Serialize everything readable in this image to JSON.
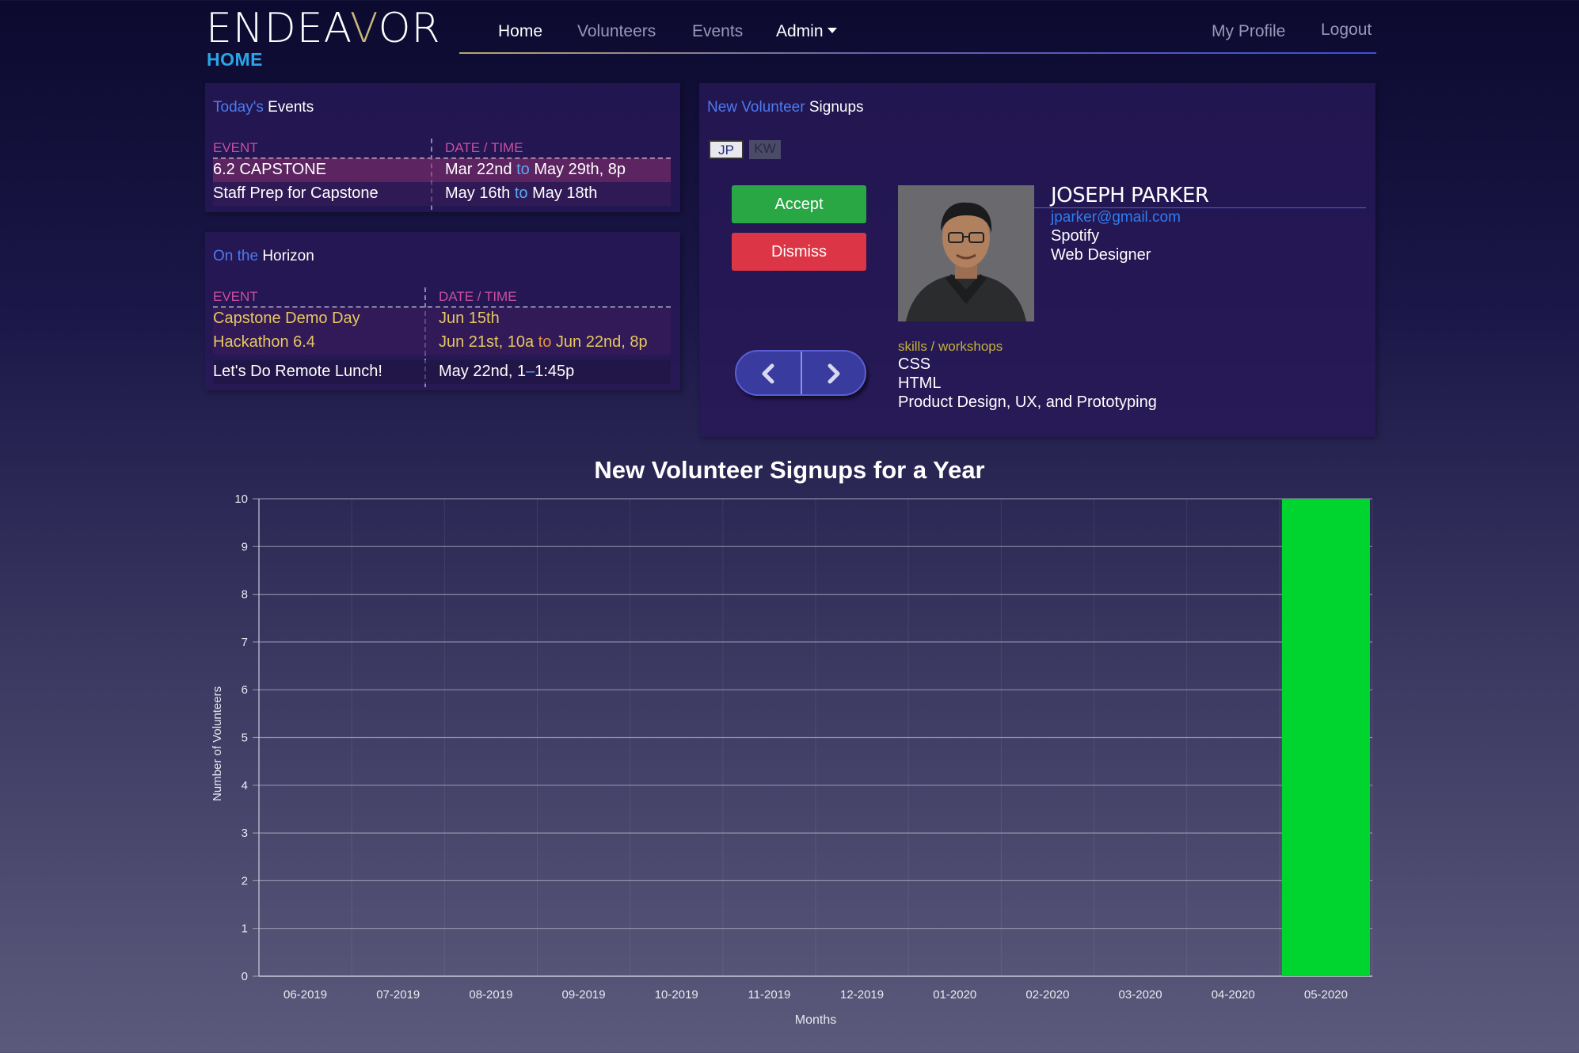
{
  "header": {
    "logo_pre": "ENDEA",
    "logo_v": "V",
    "logo_post": "OR",
    "page_label": "HOME",
    "nav": {
      "home": "Home",
      "volunteers": "Volunteers",
      "events": "Events",
      "admin": "Admin",
      "my_profile": "My Profile",
      "logout": "Logout"
    }
  },
  "todays_events": {
    "title_highlight": "Today's",
    "title_rest": " Events",
    "col_event": "EVENT",
    "col_date": "DATE / TIME",
    "rows": [
      {
        "event": "6.2 CAPSTONE",
        "start": "Mar 22nd",
        "sep": "to",
        "end": "May 29th, 8p"
      },
      {
        "event": "Staff Prep for Capstone",
        "start": "May 16th",
        "sep": "to",
        "end": "May 18th"
      }
    ]
  },
  "horizon": {
    "title_highlight": "On the",
    "title_rest": " Horizon",
    "col_event": "EVENT",
    "col_date": "DATE / TIME",
    "rows": [
      {
        "event": "Capstone Demo Day",
        "date": "Jun 15th"
      },
      {
        "event": "Hackathon 6.4",
        "start": "Jun 21st, 10a",
        "sep": "to",
        "end": "Jun 22nd, 8p"
      },
      {
        "event": "Let's Do Remote Lunch!",
        "start": "May 22nd, 1",
        "sep": "–",
        "end": "1:45p"
      }
    ]
  },
  "signups": {
    "title_highlight": "New Volunteer",
    "title_rest": " Signups",
    "tabs": [
      "JP",
      "KW"
    ],
    "accept_label": "Accept",
    "dismiss_label": "Dismiss",
    "volunteer": {
      "name": "JOSEPH PARKER",
      "email": "jparker@gmail.com",
      "company": "Spotify",
      "role": "Web Designer",
      "skills_label": "skills / workshops",
      "skills": [
        "CSS",
        "HTML",
        "Product Design, UX, and Prototyping"
      ]
    }
  },
  "colors": {
    "accent_blue": "#4d7af0",
    "accept": "#29a745",
    "dismiss": "#dc3545",
    "bar": "#00d42f"
  },
  "chart_data": {
    "type": "bar",
    "title": "New Volunteer Signups for a Year",
    "xlabel": "Months",
    "ylabel": "Number of Volunteers",
    "categories": [
      "06-2019",
      "07-2019",
      "08-2019",
      "09-2019",
      "10-2019",
      "11-2019",
      "12-2019",
      "01-2020",
      "02-2020",
      "03-2020",
      "04-2020",
      "05-2020"
    ],
    "values": [
      0,
      0,
      0,
      0,
      0,
      0,
      0,
      0,
      0,
      0,
      0,
      10
    ],
    "ylim": [
      0,
      10
    ],
    "yticks": [
      0,
      1,
      2,
      3,
      4,
      5,
      6,
      7,
      8,
      9,
      10
    ],
    "grid": true,
    "legend": "none"
  }
}
